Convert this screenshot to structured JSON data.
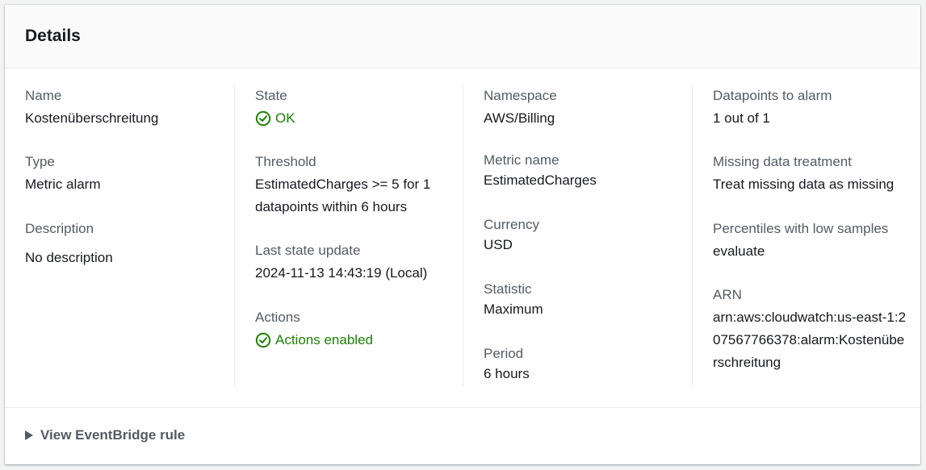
{
  "panel": {
    "title": "Details",
    "footer_link": "View EventBridge rule"
  },
  "columns": [
    {
      "fields": [
        {
          "label": "Name",
          "value": "Kostenüberschreitung"
        },
        {
          "label": "Type",
          "value": "Metric alarm"
        },
        {
          "label": "Description",
          "value": "No description"
        }
      ]
    },
    {
      "fields": [
        {
          "label": "State",
          "value": "OK"
        },
        {
          "label": "Threshold",
          "value": "EstimatedCharges >= 5 for 1 datapoints within 6 hours"
        },
        {
          "label": "Last state update",
          "value": "2024-11-13 14:43:19 (Local)"
        },
        {
          "label": "Actions",
          "value": "Actions enabled"
        }
      ]
    },
    {
      "fields": [
        {
          "label": "Namespace",
          "value": "AWS/Billing"
        },
        {
          "label": "Metric name",
          "value": "EstimatedCharges"
        },
        {
          "label": "Currency",
          "value": "USD"
        },
        {
          "label": "Statistic",
          "value": "Maximum"
        },
        {
          "label": "Period",
          "value": "6 hours"
        }
      ]
    },
    {
      "fields": [
        {
          "label": "Datapoints to alarm",
          "value": "1 out of 1"
        },
        {
          "label": "Missing data treatment",
          "value": "Treat missing data as missing"
        },
        {
          "label": "Percentiles with low samples",
          "value": "evaluate"
        },
        {
          "label": "ARN",
          "value": "arn:aws:cloudwatch:us-east-1:207567766378:alarm:Kostenüberschreitung"
        }
      ]
    }
  ],
  "colors": {
    "status_ok": "#1d8102",
    "label": "#545b64",
    "value": "#16191f"
  },
  "icons": {
    "state": "status-ok-icon",
    "actions": "status-ok-icon",
    "expander": "caret-right-icon"
  }
}
